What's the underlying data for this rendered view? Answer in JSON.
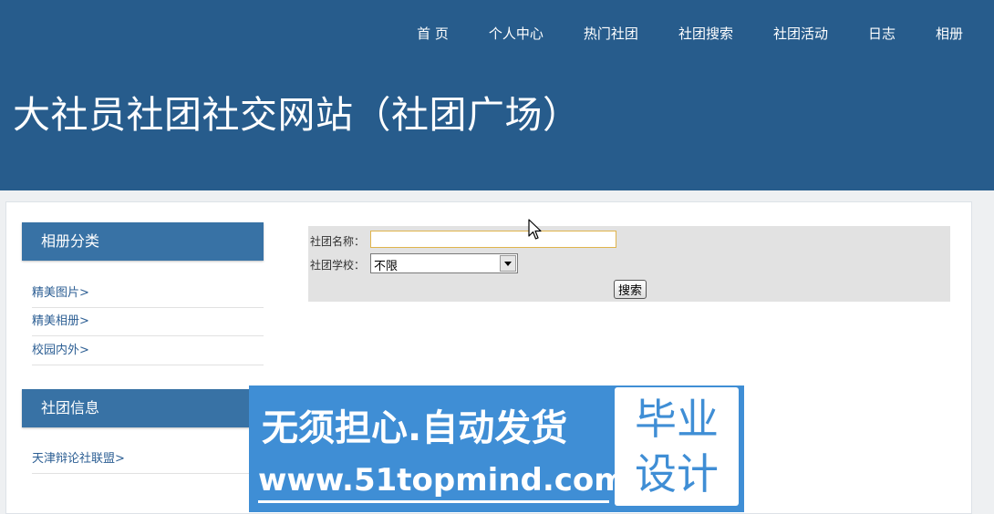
{
  "header": {
    "nav": [
      "首 页",
      "个人中心",
      "热门社团",
      "社团搜索",
      "社团活动",
      "日志",
      "相册"
    ],
    "title": "大社员社团社交网站（社团广场）"
  },
  "sidebar": {
    "album_category": {
      "title": "相册分类",
      "items": [
        "精美图片>",
        "精美相册>",
        "校园内外>"
      ]
    },
    "club_info": {
      "title": "社团信息",
      "items": [
        "天津辩论社联盟>"
      ]
    }
  },
  "search": {
    "name_label": "社团名称：",
    "name_value": "",
    "school_label": "社团学校：",
    "school_selected": "不限",
    "button_label": "搜索"
  },
  "watermark": {
    "line1": "无须担心.自动发货",
    "line2": "www.51topmind.com",
    "badge_line1": "毕业",
    "badge_line2": "设计"
  },
  "colors": {
    "header_bg": "#275c8c",
    "sidebar_header_bg": "#3872a5",
    "link": "#2d5f94",
    "watermark_bg": "#3f8ed5"
  }
}
